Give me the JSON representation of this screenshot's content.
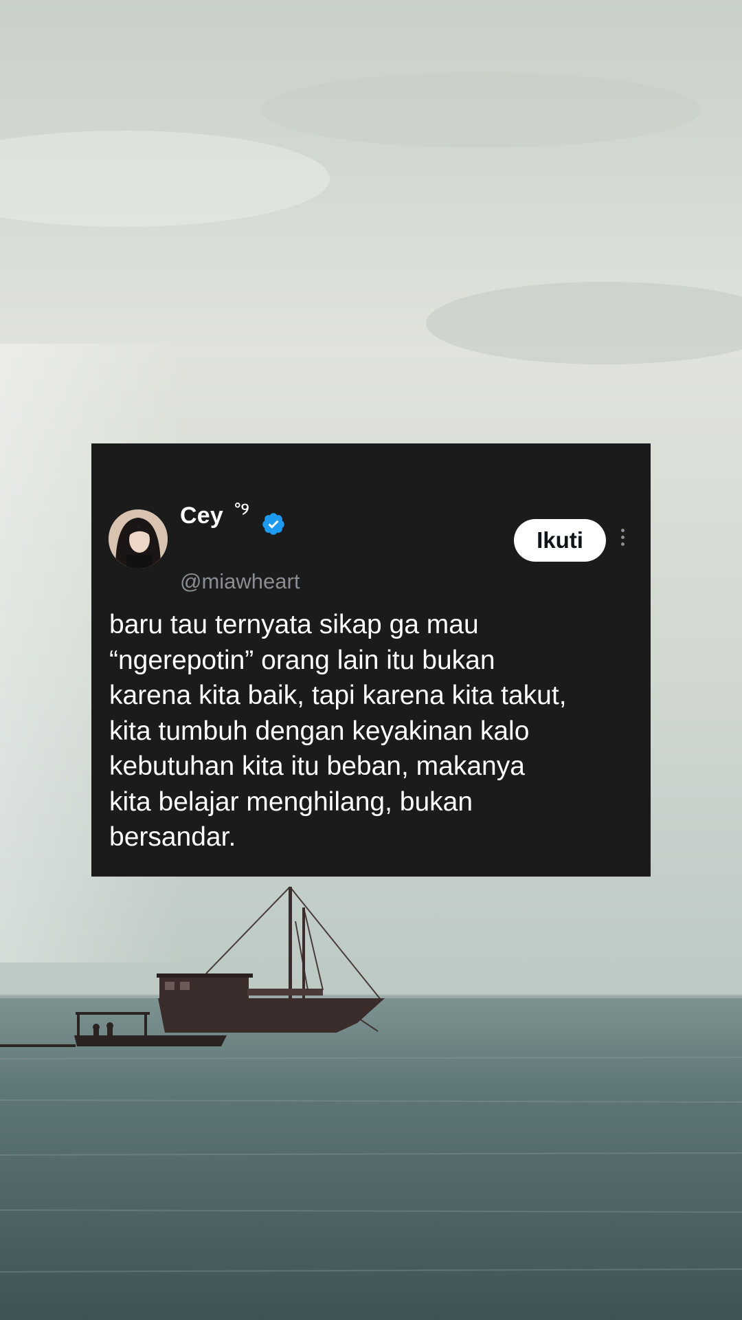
{
  "tweet": {
    "display_name": "Cey",
    "name_emoji": "°୨",
    "verified": true,
    "verified_color": "#1d9bf0",
    "handle": "@miawheart",
    "follow_label": "Ikuti",
    "more_icon": "more-vertical-icon",
    "text": "baru tau ternyata sikap ga mau\n“ngerepotin” orang lain itu bukan\nkarena kita baik, tapi karena kita takut,\nkita tumbuh dengan keyakinan kalo\nkebutuhan kita itu beban, makanya\nkita belajar menghilang, bukan\nbersandar."
  },
  "background": {
    "description_icon": "sea-boat-background",
    "sky_color": "#d6dcd3",
    "sea_color": "#5e7473"
  }
}
